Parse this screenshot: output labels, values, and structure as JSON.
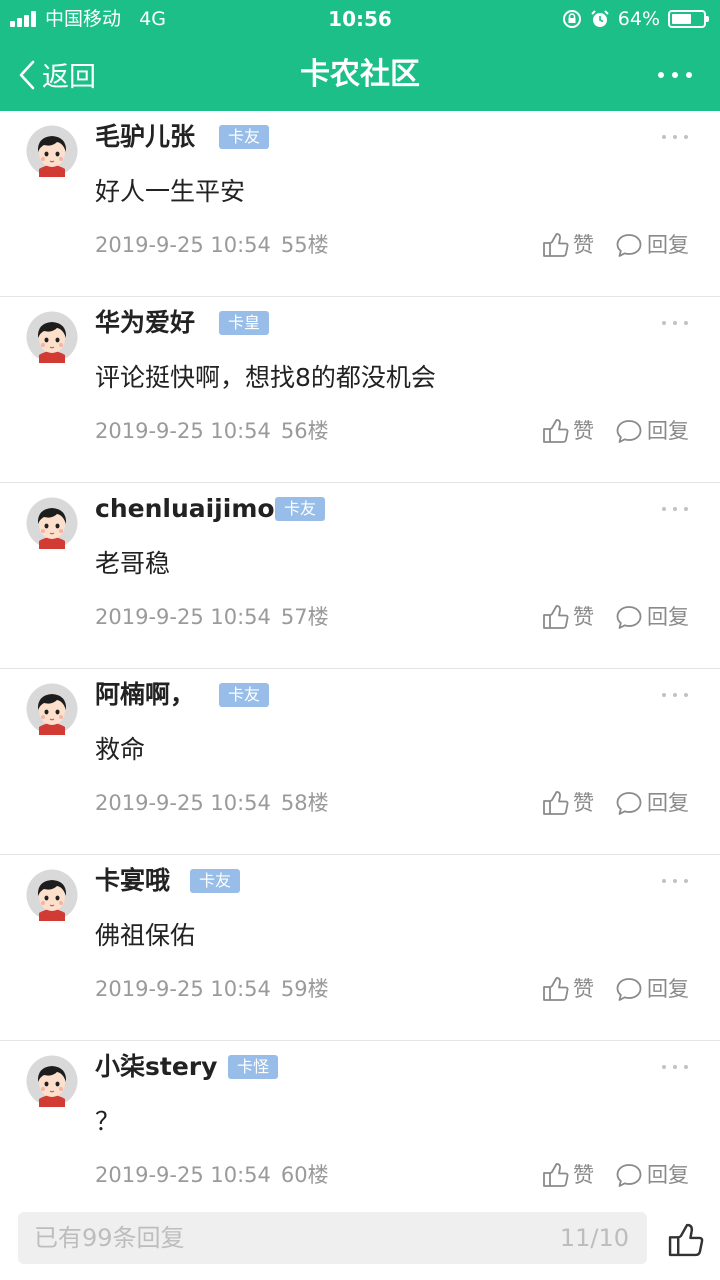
{
  "status_bar": {
    "carrier": "中国移动",
    "network": "4G",
    "time": "10:56",
    "battery": "64%",
    "battery_level": 0.64
  },
  "nav": {
    "back_label": "返回",
    "title": "卡农社区"
  },
  "colors": {
    "brand_green": "#1cbf88",
    "badge_blue": "#97bde8"
  },
  "posts": [
    {
      "username": "毛驴儿张",
      "badge": "卡友",
      "content": "好人一生平安",
      "time": "2019-9-25 10:54",
      "floor": "55楼",
      "like_label": "赞",
      "reply_label": "回复"
    },
    {
      "username": "华为爱好",
      "badge": "卡皇",
      "content": "评论挺快啊，想找8的都没机会",
      "time": "2019-9-25 10:54",
      "floor": "56楼",
      "like_label": "赞",
      "reply_label": "回复"
    },
    {
      "username": "chenluaijimo",
      "badge": "卡友",
      "content": "老哥稳",
      "time": "2019-9-25 10:54",
      "floor": "57楼",
      "like_label": "赞",
      "reply_label": "回复"
    },
    {
      "username": "阿楠啊，",
      "badge": "卡友",
      "content": "救命",
      "time": "2019-9-25 10:54",
      "floor": "58楼",
      "like_label": "赞",
      "reply_label": "回复"
    },
    {
      "username": "卡宴哦",
      "badge": "卡友",
      "content": "佛祖保佑",
      "time": "2019-9-25 10:54",
      "floor": "59楼",
      "like_label": "赞",
      "reply_label": "回复"
    },
    {
      "username": "小柒stery",
      "badge": "卡怪",
      "content": "？",
      "time": "2019-9-25 10:54",
      "floor": "60楼",
      "like_label": "赞",
      "reply_label": "回复"
    }
  ],
  "reply_bar": {
    "placeholder": "已有99条回复",
    "page_indicator": "11/10"
  },
  "icons": [
    "signal-icon",
    "alarm-lock-icon",
    "alarm-icon",
    "battery-icon",
    "back-chevron-icon",
    "more-icon",
    "avatar",
    "more-dots-icon",
    "thumb-up-icon",
    "comment-icon"
  ]
}
